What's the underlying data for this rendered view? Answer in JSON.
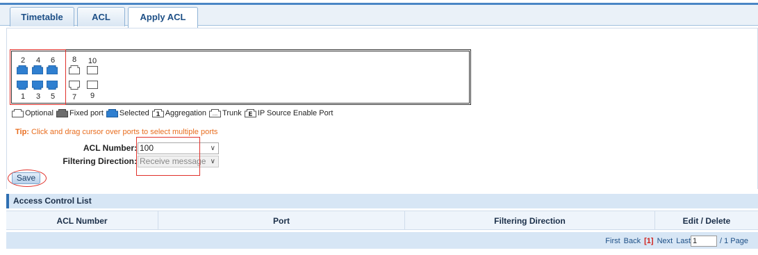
{
  "tabs": [
    {
      "label": "Timetable",
      "active": false
    },
    {
      "label": "ACL",
      "active": false
    },
    {
      "label": "Apply ACL",
      "active": true
    }
  ],
  "ports": {
    "top": [
      {
        "number": "2",
        "state": "selected"
      },
      {
        "number": "4",
        "state": "selected"
      },
      {
        "number": "6",
        "state": "selected"
      },
      {
        "number": "8",
        "state": "optional"
      },
      {
        "number": "10",
        "state": "optional-fiber"
      }
    ],
    "bottom": [
      {
        "number": "1",
        "state": "selected"
      },
      {
        "number": "3",
        "state": "selected"
      },
      {
        "number": "5",
        "state": "selected"
      },
      {
        "number": "7",
        "state": "optional"
      },
      {
        "number": "9",
        "state": "optional-fiber"
      }
    ]
  },
  "legend": [
    {
      "icon": "optional-port-icon",
      "label": "Optional"
    },
    {
      "icon": "fixed-port-icon",
      "label": "Fixed port"
    },
    {
      "icon": "selected-port-icon",
      "label": "Selected"
    },
    {
      "icon": "aggregation-icon",
      "glyph": "1",
      "label": "Aggregation"
    },
    {
      "icon": "trunk-icon",
      "glyph": "...",
      "label": "Trunk"
    },
    {
      "icon": "ip-source-icon",
      "glyph": "E",
      "label": "IP Source Enable Port"
    }
  ],
  "tip": {
    "prefix": "Tip:",
    "text": "Click and drag cursor over ports to select multiple ports"
  },
  "form": {
    "acl_number_label": "ACL Number:",
    "acl_number_value": "100",
    "filtering_direction_label": "Filtering Direction:",
    "filtering_direction_value": "Receive message",
    "save_label": "Save"
  },
  "acl_list": {
    "title": "Access Control List",
    "columns": [
      "ACL Number",
      "Port",
      "Filtering Direction",
      "Edit / Delete"
    ]
  },
  "pager": {
    "first": "First",
    "back": "Back",
    "current": "[1]",
    "next": "Next",
    "last": "Last",
    "page_input": "1",
    "total": "/ 1 Page"
  },
  "colors": {
    "selected_port": "#2f7fd0",
    "tip": "#e86d1f",
    "highlight": "#e0302a",
    "accent": "#2f6fb2"
  }
}
